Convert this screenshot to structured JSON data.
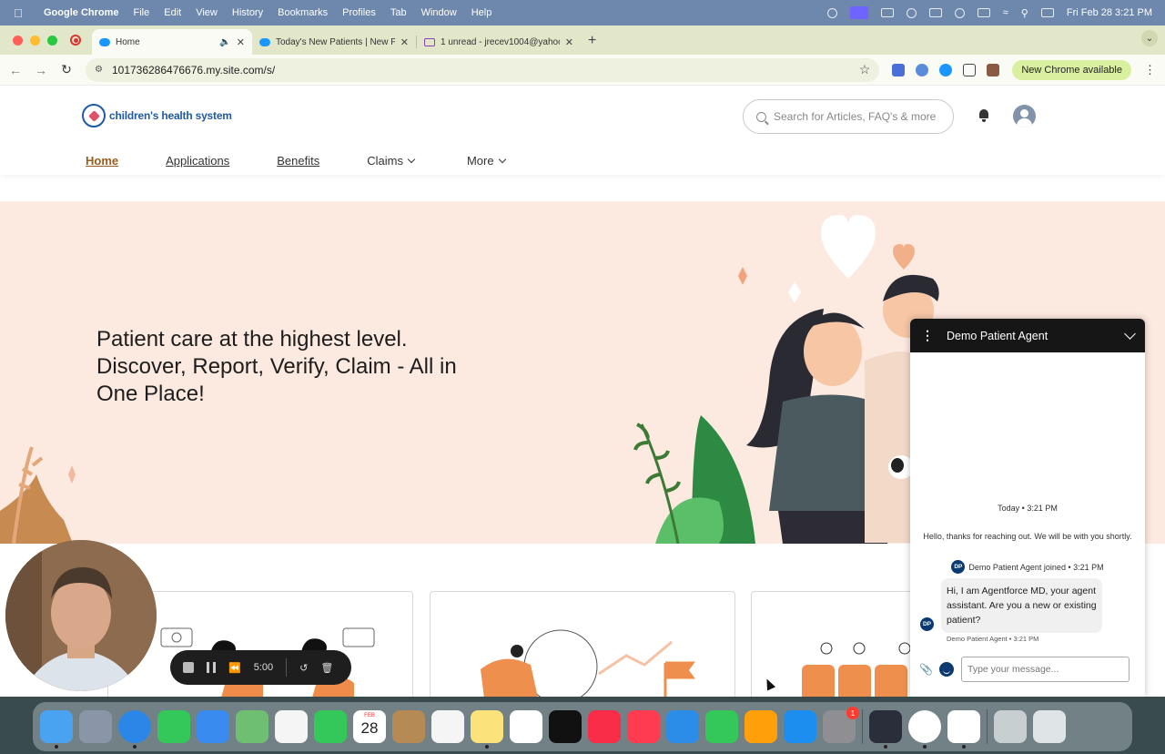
{
  "menubar": {
    "app_name": "Google Chrome",
    "menus": [
      "File",
      "Edit",
      "View",
      "History",
      "Bookmarks",
      "Profiles",
      "Tab",
      "Window",
      "Help"
    ],
    "datetime": "Fri Feb 28  3:21 PM"
  },
  "tabs": [
    {
      "title": "Home",
      "active": true
    },
    {
      "title": "Today's New Patients | New P",
      "active": false
    },
    {
      "title": "1 unread - jrecev1004@yahoo",
      "active": false
    }
  ],
  "toolbar": {
    "url": "101736286476676.my.site.com/s/",
    "new_chrome": "New Chrome available"
  },
  "site": {
    "logo_text": "children's health system",
    "search_placeholder": "Search for Articles, FAQ's & more",
    "nav": {
      "home": "Home",
      "applications": "Applications",
      "benefits": "Benefits",
      "claims": "Claims",
      "more": "More"
    },
    "hero_line1": "Patient care at the highest level.",
    "hero_line2": "Discover, Report, Verify, Claim - All in",
    "hero_line3": "One Place!"
  },
  "chat": {
    "title": "Demo Patient Agent",
    "time_divider": "Today • 3:21 PM",
    "system_message": "Hello, thanks for reaching out. We will be with you shortly.",
    "avatar_initials": "DP",
    "joined_text": "Demo Patient Agent joined • 3:21 PM",
    "agent_message": "Hi, I am Agentforce MD, your agent assistant. Are you a new or existing patient?",
    "agent_meta": "Demo Patient Agent • 3:21 PM",
    "input_placeholder": "Type your message..."
  },
  "recorder": {
    "timer": "5:00"
  },
  "dock": {
    "calendar_month": "FEB",
    "calendar_day": "28",
    "system_settings_badge": "1"
  },
  "colors": {
    "hero_bg": "#fce9e0",
    "brand_blue": "#1f5aa6",
    "nav_active": "#9a5d1a",
    "chat_header": "#161616",
    "agent_avatar": "#0b3a72"
  }
}
